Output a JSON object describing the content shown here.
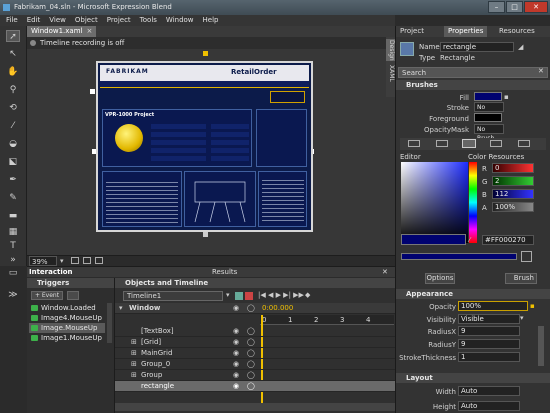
{
  "window": {
    "title": "Fabrikam_04.sln - Microsoft Expression Blend"
  },
  "menu": [
    "File",
    "Edit",
    "View",
    "Object",
    "Project",
    "Tools",
    "Window",
    "Help"
  ],
  "document": {
    "tab_label": "Window1.xaml",
    "recording_status": "Timeline recording is off",
    "zoom": "39%"
  },
  "design": {
    "brand": "FABRIKAM",
    "logo_text": "RetailOrder",
    "project_title": "VPR-1000 Project"
  },
  "bottom_tabs": {
    "interaction": "Interaction",
    "results": "Results"
  },
  "triggers": {
    "header": "Triggers",
    "add_event": "+ Event",
    "items": [
      "Window.Loaded",
      "Image4.MouseUp",
      "Image.MouseUp",
      "Image1.MouseUp"
    ]
  },
  "objects": {
    "header": "Objects and Timeline",
    "timeline_name": "Timeline1",
    "root": "Window",
    "time": "0:00.000",
    "ticks": [
      "0",
      "1",
      "2",
      "3",
      "4"
    ],
    "items": [
      "[TextBox]",
      "[Grid]",
      "MainGrid",
      "Group_0",
      "Group",
      "rectangle"
    ]
  },
  "panel": {
    "tabs": [
      "Project",
      "Properties",
      "Resources"
    ],
    "side_tabs": [
      "Design",
      "XAML"
    ],
    "name_label": "Name",
    "name_value": "rectangle",
    "type_label": "Type",
    "type_value": "Rectangle",
    "search_placeholder": "Search",
    "brushes_header": "Brushes",
    "fill_label": "Fill",
    "stroke_label": "Stroke",
    "stroke_value": "No Brush",
    "foreground_label": "Foreground",
    "opacitymask_label": "OpacityMask",
    "opacitymask_value": "No Brush",
    "editor_label": "Editor",
    "color_resources": "Color Resources",
    "r_label": "R",
    "r_value": "0",
    "g_label": "G",
    "g_value": "2",
    "b_label": "B",
    "b_value": "112",
    "a_label": "A",
    "a_value": "100%",
    "hex_value": "#FF000270",
    "options_label": "Options",
    "brush_label": "Brush",
    "appearance_header": "Appearance",
    "opacity_label": "Opacity",
    "opacity_value": "100%",
    "visibility_label": "Visibility",
    "visibility_value": "Visible",
    "radiusx_label": "RadiusX",
    "radiusx_value": "9",
    "radiusy_label": "RadiusY",
    "radiusy_value": "9",
    "strokethickness_label": "StrokeThickness",
    "strokethickness_value": "1",
    "layout_header": "Layout",
    "width_label": "Width",
    "width_value": "Auto",
    "height_label": "Height",
    "height_value": "Auto"
  },
  "colors": {
    "fill": "#000270",
    "accent": "#f0c000",
    "panel_highlight": "#5a5a5a"
  }
}
